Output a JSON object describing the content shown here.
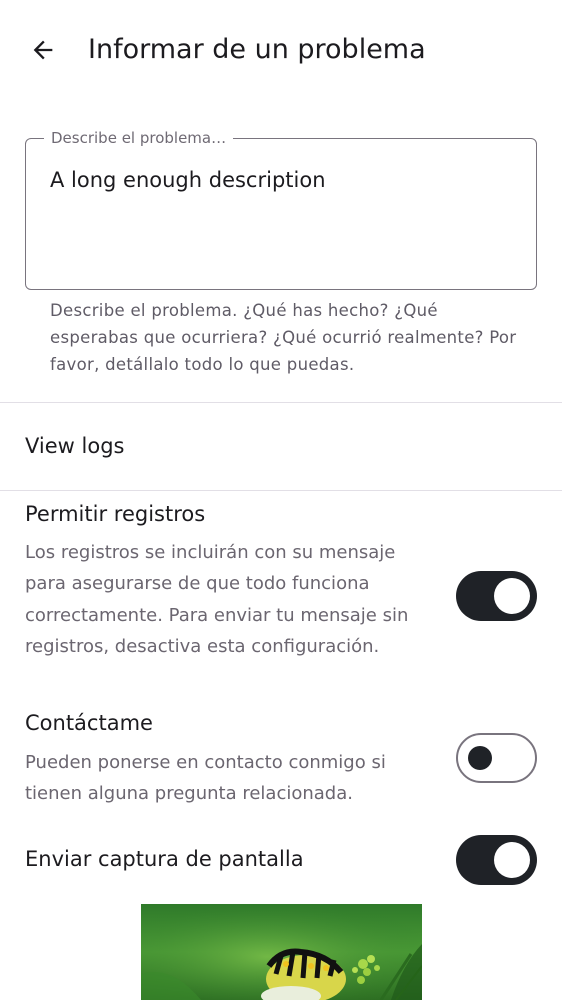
{
  "header": {
    "title": "Informar de un problema",
    "back_icon": "arrow-left-icon"
  },
  "description_field": {
    "label": "Describe el problema…",
    "value": "A long enough description",
    "helper": "Describe el problema. ¿Qué has hecho? ¿Qué esperabas que ocurriera? ¿Qué ocurrió realmente? Por favor, detállalo todo lo que puedas."
  },
  "view_logs": {
    "label": "View logs"
  },
  "settings": [
    {
      "title": "Permitir registros",
      "description": "Los registros se incluirán con su mensaje para asegurarse de que todo funciona correctamente. Para enviar tu mensaje sin registros, desactiva esta configuración.",
      "enabled": true
    },
    {
      "title": "Contáctame",
      "description": "Pueden ponerse en contacto conmigo si tienen alguna pregunta relacionada.",
      "enabled": false
    },
    {
      "title": "Enviar captura de pantalla",
      "enabled": true
    }
  ],
  "colors": {
    "switch_on_track": "#1f2227",
    "switch_off_border": "#79747e",
    "text_primary": "#1c1b1f",
    "text_secondary": "#6b6670"
  }
}
